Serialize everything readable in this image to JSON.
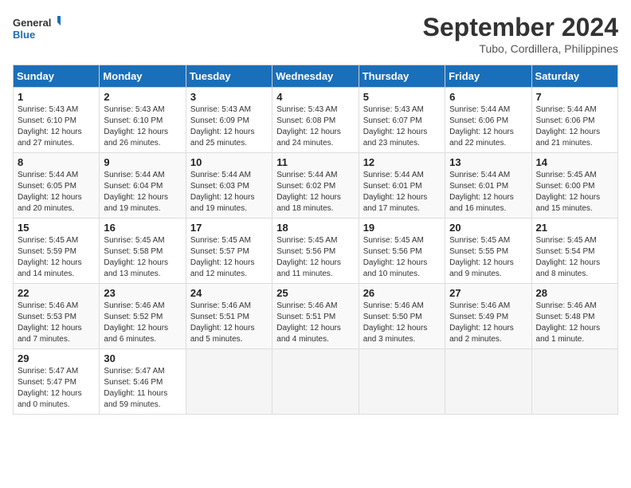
{
  "logo": {
    "text1": "General",
    "text2": "Blue"
  },
  "title": "September 2024",
  "subtitle": "Tubo, Cordillera, Philippines",
  "headers": [
    "Sunday",
    "Monday",
    "Tuesday",
    "Wednesday",
    "Thursday",
    "Friday",
    "Saturday"
  ],
  "weeks": [
    [
      {
        "day": "1",
        "sunrise": "Sunrise: 5:43 AM",
        "sunset": "Sunset: 6:10 PM",
        "daylight": "Daylight: 12 hours and 27 minutes."
      },
      {
        "day": "2",
        "sunrise": "Sunrise: 5:43 AM",
        "sunset": "Sunset: 6:10 PM",
        "daylight": "Daylight: 12 hours and 26 minutes."
      },
      {
        "day": "3",
        "sunrise": "Sunrise: 5:43 AM",
        "sunset": "Sunset: 6:09 PM",
        "daylight": "Daylight: 12 hours and 25 minutes."
      },
      {
        "day": "4",
        "sunrise": "Sunrise: 5:43 AM",
        "sunset": "Sunset: 6:08 PM",
        "daylight": "Daylight: 12 hours and 24 minutes."
      },
      {
        "day": "5",
        "sunrise": "Sunrise: 5:43 AM",
        "sunset": "Sunset: 6:07 PM",
        "daylight": "Daylight: 12 hours and 23 minutes."
      },
      {
        "day": "6",
        "sunrise": "Sunrise: 5:44 AM",
        "sunset": "Sunset: 6:06 PM",
        "daylight": "Daylight: 12 hours and 22 minutes."
      },
      {
        "day": "7",
        "sunrise": "Sunrise: 5:44 AM",
        "sunset": "Sunset: 6:06 PM",
        "daylight": "Daylight: 12 hours and 21 minutes."
      }
    ],
    [
      {
        "day": "8",
        "sunrise": "Sunrise: 5:44 AM",
        "sunset": "Sunset: 6:05 PM",
        "daylight": "Daylight: 12 hours and 20 minutes."
      },
      {
        "day": "9",
        "sunrise": "Sunrise: 5:44 AM",
        "sunset": "Sunset: 6:04 PM",
        "daylight": "Daylight: 12 hours and 19 minutes."
      },
      {
        "day": "10",
        "sunrise": "Sunrise: 5:44 AM",
        "sunset": "Sunset: 6:03 PM",
        "daylight": "Daylight: 12 hours and 19 minutes."
      },
      {
        "day": "11",
        "sunrise": "Sunrise: 5:44 AM",
        "sunset": "Sunset: 6:02 PM",
        "daylight": "Daylight: 12 hours and 18 minutes."
      },
      {
        "day": "12",
        "sunrise": "Sunrise: 5:44 AM",
        "sunset": "Sunset: 6:01 PM",
        "daylight": "Daylight: 12 hours and 17 minutes."
      },
      {
        "day": "13",
        "sunrise": "Sunrise: 5:44 AM",
        "sunset": "Sunset: 6:01 PM",
        "daylight": "Daylight: 12 hours and 16 minutes."
      },
      {
        "day": "14",
        "sunrise": "Sunrise: 5:45 AM",
        "sunset": "Sunset: 6:00 PM",
        "daylight": "Daylight: 12 hours and 15 minutes."
      }
    ],
    [
      {
        "day": "15",
        "sunrise": "Sunrise: 5:45 AM",
        "sunset": "Sunset: 5:59 PM",
        "daylight": "Daylight: 12 hours and 14 minutes."
      },
      {
        "day": "16",
        "sunrise": "Sunrise: 5:45 AM",
        "sunset": "Sunset: 5:58 PM",
        "daylight": "Daylight: 12 hours and 13 minutes."
      },
      {
        "day": "17",
        "sunrise": "Sunrise: 5:45 AM",
        "sunset": "Sunset: 5:57 PM",
        "daylight": "Daylight: 12 hours and 12 minutes."
      },
      {
        "day": "18",
        "sunrise": "Sunrise: 5:45 AM",
        "sunset": "Sunset: 5:56 PM",
        "daylight": "Daylight: 12 hours and 11 minutes."
      },
      {
        "day": "19",
        "sunrise": "Sunrise: 5:45 AM",
        "sunset": "Sunset: 5:56 PM",
        "daylight": "Daylight: 12 hours and 10 minutes."
      },
      {
        "day": "20",
        "sunrise": "Sunrise: 5:45 AM",
        "sunset": "Sunset: 5:55 PM",
        "daylight": "Daylight: 12 hours and 9 minutes."
      },
      {
        "day": "21",
        "sunrise": "Sunrise: 5:45 AM",
        "sunset": "Sunset: 5:54 PM",
        "daylight": "Daylight: 12 hours and 8 minutes."
      }
    ],
    [
      {
        "day": "22",
        "sunrise": "Sunrise: 5:46 AM",
        "sunset": "Sunset: 5:53 PM",
        "daylight": "Daylight: 12 hours and 7 minutes."
      },
      {
        "day": "23",
        "sunrise": "Sunrise: 5:46 AM",
        "sunset": "Sunset: 5:52 PM",
        "daylight": "Daylight: 12 hours and 6 minutes."
      },
      {
        "day": "24",
        "sunrise": "Sunrise: 5:46 AM",
        "sunset": "Sunset: 5:51 PM",
        "daylight": "Daylight: 12 hours and 5 minutes."
      },
      {
        "day": "25",
        "sunrise": "Sunrise: 5:46 AM",
        "sunset": "Sunset: 5:51 PM",
        "daylight": "Daylight: 12 hours and 4 minutes."
      },
      {
        "day": "26",
        "sunrise": "Sunrise: 5:46 AM",
        "sunset": "Sunset: 5:50 PM",
        "daylight": "Daylight: 12 hours and 3 minutes."
      },
      {
        "day": "27",
        "sunrise": "Sunrise: 5:46 AM",
        "sunset": "Sunset: 5:49 PM",
        "daylight": "Daylight: 12 hours and 2 minutes."
      },
      {
        "day": "28",
        "sunrise": "Sunrise: 5:46 AM",
        "sunset": "Sunset: 5:48 PM",
        "daylight": "Daylight: 12 hours and 1 minute."
      }
    ],
    [
      {
        "day": "29",
        "sunrise": "Sunrise: 5:47 AM",
        "sunset": "Sunset: 5:47 PM",
        "daylight": "Daylight: 12 hours and 0 minutes."
      },
      {
        "day": "30",
        "sunrise": "Sunrise: 5:47 AM",
        "sunset": "Sunset: 5:46 PM",
        "daylight": "Daylight: 11 hours and 59 minutes."
      },
      null,
      null,
      null,
      null,
      null
    ]
  ]
}
